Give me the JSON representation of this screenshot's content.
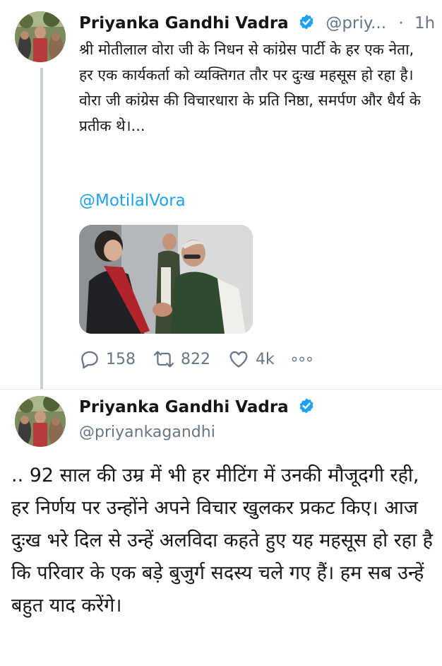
{
  "tweet1": {
    "author_name": "Priyanka Gandhi Vadra",
    "handle": "@priy...",
    "separator": "·",
    "time": "1h",
    "text": "श्री मोतीलाल वोरा जी के निधन से कांग्रेस पार्टी के हर एक नेता, हर एक कार्यकर्ता को व्यक्तिगत तौर पर दुःख महसूस हो रहा है। वोरा जी कांग्रेस की विचारधारा के प्रति निष्ठा, समर्पण और धैर्य के प्रतीक थे।...",
    "mention": "@MotilalVora",
    "actions": {
      "reply_count": "158",
      "retweet_count": "822",
      "like_count": "4k",
      "more_label": "∘∘∘"
    }
  },
  "tweet2": {
    "author_name": "Priyanka Gandhi Vadra",
    "handle": "@priyankagandhi",
    "text": ".. 92 साल की उम्र में भी हर मीटिंग में उनकी मौजूदगी रही, हर निर्णय पर उन्होंने अपने विचार खुलकर प्रकट किए। आज दुःख भरे दिल से उन्हें अलविदा कहते हुए यह महसूस हो रहा है कि परिवार के एक बड़े बुजुर्ग सदस्य चले गए हैं। हम सब उन्हें बहुत याद करेंगे।"
  },
  "icons": [
    "verified-badge-icon",
    "reply-icon",
    "retweet-icon",
    "like-icon",
    "more-icon"
  ],
  "colors": {
    "text": "#14171a",
    "secondary": "#657786",
    "link": "#1da1f2",
    "verified": "#1da1f2",
    "thread_line": "#c4cfd6"
  }
}
